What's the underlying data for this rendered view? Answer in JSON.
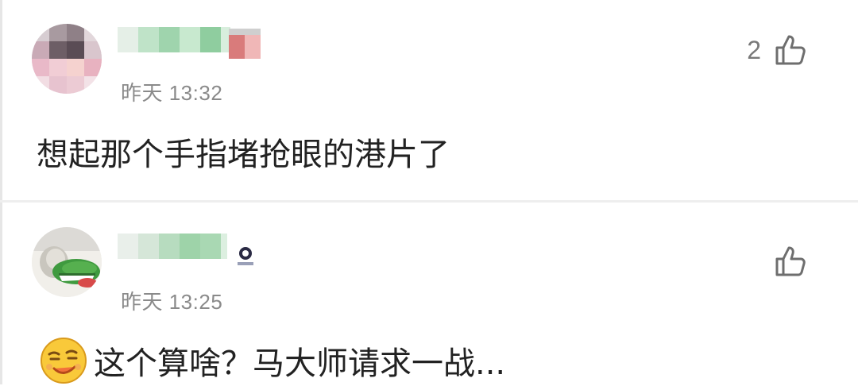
{
  "comments": [
    {
      "user_name": "",
      "time": "昨天 13:32",
      "likes": "2",
      "text": "想起那个手指堵抢眼的港片了"
    },
    {
      "user_name": "",
      "time": "昨天 13:25",
      "likes": "",
      "text": "这个算啥？马大师请求一战..."
    }
  ],
  "icons": {
    "like": "thumbs-up-icon",
    "emoji": "smirk-emoji-icon"
  },
  "colors": {
    "username_green": "#4caf6a",
    "time_gray": "#8a8a8a",
    "text": "#222222",
    "divider": "#eeeeee"
  }
}
